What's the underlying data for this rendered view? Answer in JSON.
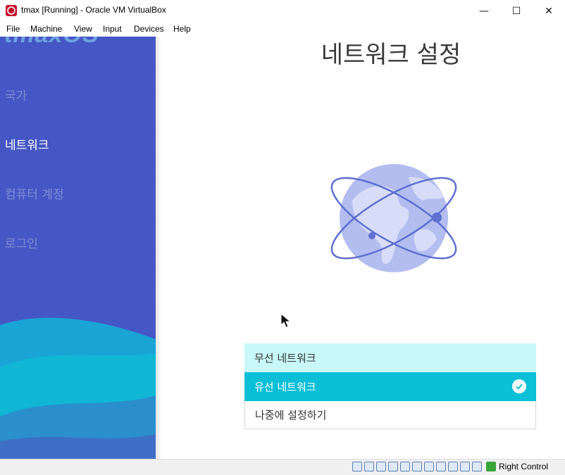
{
  "window": {
    "title": "tmax [Running] - Oracle VM VirtualBox",
    "minimize_glyph": "—",
    "maximize_glyph": "☐",
    "close_glyph": "✕"
  },
  "menu": [
    "File",
    "Machine",
    "View",
    "Input",
    "Devices",
    "Help"
  ],
  "sidebar": {
    "brand": "tmaxOS",
    "items": [
      {
        "label": "국가",
        "active": false
      },
      {
        "label": "네트워크",
        "active": true
      },
      {
        "label": "컴퓨터 계정",
        "active": false
      },
      {
        "label": "로그인",
        "active": false
      }
    ]
  },
  "main": {
    "title": "네트워크 설정",
    "options": [
      {
        "label": "무선 네트워크",
        "selected": false
      },
      {
        "label": "유선 네트워크",
        "selected": true
      },
      {
        "label": "나중에 설정하기",
        "selected": false
      }
    ]
  },
  "statusbar": {
    "host_key": "Right Control"
  },
  "colors": {
    "sidebar": "#4557c4",
    "accent": "#0bbfd7",
    "hover": "#c8f8f8"
  }
}
